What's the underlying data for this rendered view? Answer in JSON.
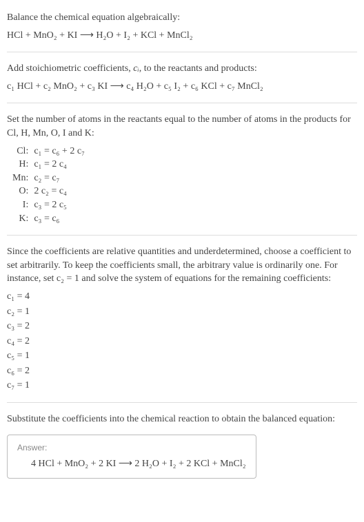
{
  "intro1": "Balance the chemical equation algebraically:",
  "eq1": "HCl + MnO₂ + KI ⟶ H₂O + I₂ + KCl + MnCl₂",
  "step2a": "Add stoichiometric coefficients, ",
  "step2var": "cᵢ",
  "step2b": ", to the reactants and products:",
  "eq2": "c₁ HCl + c₂ MnO₂ + c₃ KI ⟶ c₄ H₂O + c₅ I₂ + c₆ KCl + c₇ MnCl₂",
  "step3": "Set the number of atoms in the reactants equal to the number of atoms in the products for Cl, H, Mn, O, I and K:",
  "atoms": [
    {
      "el": "Cl:",
      "eq": "c₁ = c₆ + 2 c₇"
    },
    {
      "el": "H:",
      "eq": "c₁ = 2 c₄"
    },
    {
      "el": "Mn:",
      "eq": "c₂ = c₇"
    },
    {
      "el": "O:",
      "eq": "2 c₂ = c₄"
    },
    {
      "el": "I:",
      "eq": "c₃ = 2 c₅"
    },
    {
      "el": "K:",
      "eq": "c₃ = c₆"
    }
  ],
  "step4": "Since the coefficients are relative quantities and underdetermined, choose a coefficient to set arbitrarily. To keep the coefficients small, the arbitrary value is ordinarily one. For instance, set c₂ = 1 and solve the system of equations for the remaining coefficients:",
  "solutions": [
    "c₁ = 4",
    "c₂ = 1",
    "c₃ = 2",
    "c₄ = 2",
    "c₅ = 1",
    "c₆ = 2",
    "c₇ = 1"
  ],
  "step5": "Substitute the coefficients into the chemical reaction to obtain the balanced equation:",
  "answer_label": "Answer:",
  "answer_eq": "4 HCl + MnO₂ + 2 KI ⟶ 2 H₂O + I₂ + 2 KCl + MnCl₂",
  "chart_data": {
    "type": "table",
    "title": "Balancing HCl + MnO2 + KI → H2O + I2 + KCl + MnCl2",
    "atom_balance": {
      "Cl": "c1 = c6 + 2 c7",
      "H": "c1 = 2 c4",
      "Mn": "c2 = c7",
      "O": "2 c2 = c4",
      "I": "c3 = 2 c5",
      "K": "c3 = c6"
    },
    "solution": {
      "c1": 4,
      "c2": 1,
      "c3": 2,
      "c4": 2,
      "c5": 1,
      "c6": 2,
      "c7": 1
    },
    "balanced_equation": "4 HCl + MnO2 + 2 KI → 2 H2O + I2 + 2 KCl + MnCl2"
  }
}
